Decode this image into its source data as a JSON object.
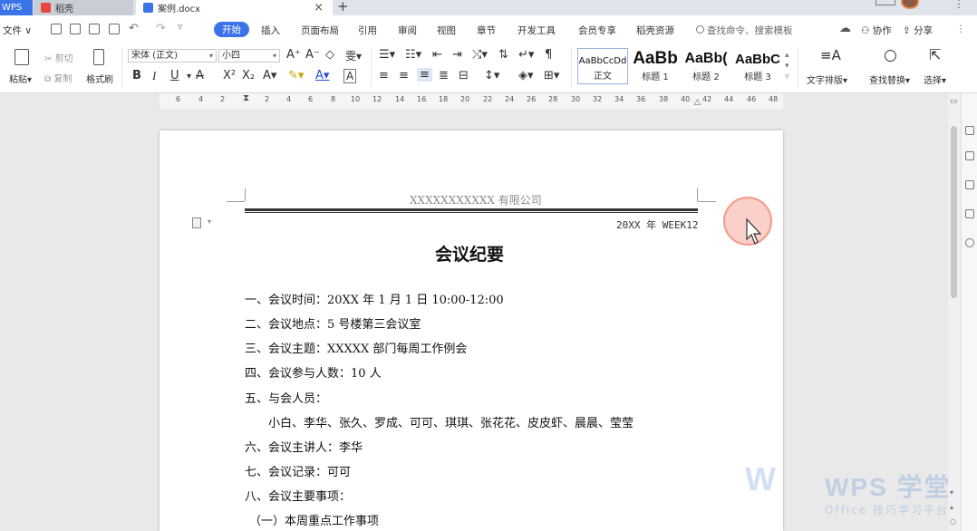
{
  "tabs": {
    "app": "WPS",
    "shell": "稻壳",
    "document": "案例.docx",
    "close": "×",
    "new_tab": "+"
  },
  "menu": {
    "file": "文件",
    "items": [
      "开始",
      "插入",
      "页面布局",
      "引用",
      "审阅",
      "视图",
      "章节",
      "开发工具",
      "会员专享",
      "稻壳资源"
    ],
    "search_placeholder": "查找命令、搜索模板",
    "collab": "协作",
    "share": "分享"
  },
  "ribbon": {
    "paste": "粘贴",
    "cut": "剪切",
    "copy": "复制",
    "format_painter": "格式刷",
    "font_name": "宋体 (正文)",
    "font_size": "小四",
    "bold": "B",
    "italic": "I",
    "underline": "U",
    "styles": [
      {
        "preview": "AaBbCcDd",
        "label": "正文"
      },
      {
        "preview": "AaBb",
        "label": "标题 1"
      },
      {
        "preview": "AaBb(",
        "label": "标题 2"
      },
      {
        "preview": "AaBbC",
        "label": "标题 3"
      }
    ],
    "text_layout": "文字排版",
    "find_replace": "查找替换",
    "select": "选择"
  },
  "ruler": {
    "numbers": [
      "6",
      "4",
      "2",
      "2",
      "4",
      "6",
      "8",
      "10",
      "12",
      "14",
      "16",
      "18",
      "20",
      "22",
      "24",
      "26",
      "28",
      "30",
      "32",
      "34",
      "36",
      "38",
      "40",
      "42",
      "44",
      "46",
      "48"
    ]
  },
  "document": {
    "header_company": "XXXXXXXXXXX 有限公司",
    "header_week": "20XX 年 WEEK12",
    "title": "会议纪要",
    "lines": [
      "一、会议时间：20XX 年 1 月 1 日  10:00-12:00",
      "二、会议地点：5 号楼第三会议室",
      "三、会议主题：XXXXX 部门每周工作例会",
      "四、会议参与人数：10 人",
      "五、与会人员：",
      "小白、李华、张久、罗成、可可、琪琪、张花花、皮皮虾、晨晨、莹莹",
      "六、会议主讲人：李华",
      "七、会议记录：可可",
      "八、会议主要事项：",
      "（一）本周重点工作事项"
    ]
  },
  "watermark": {
    "brand": "WPS 学堂",
    "sub": "Office 技巧学习平台"
  },
  "colors": {
    "accent": "#3b74e8",
    "cursor_ring": "#ee7c66"
  }
}
